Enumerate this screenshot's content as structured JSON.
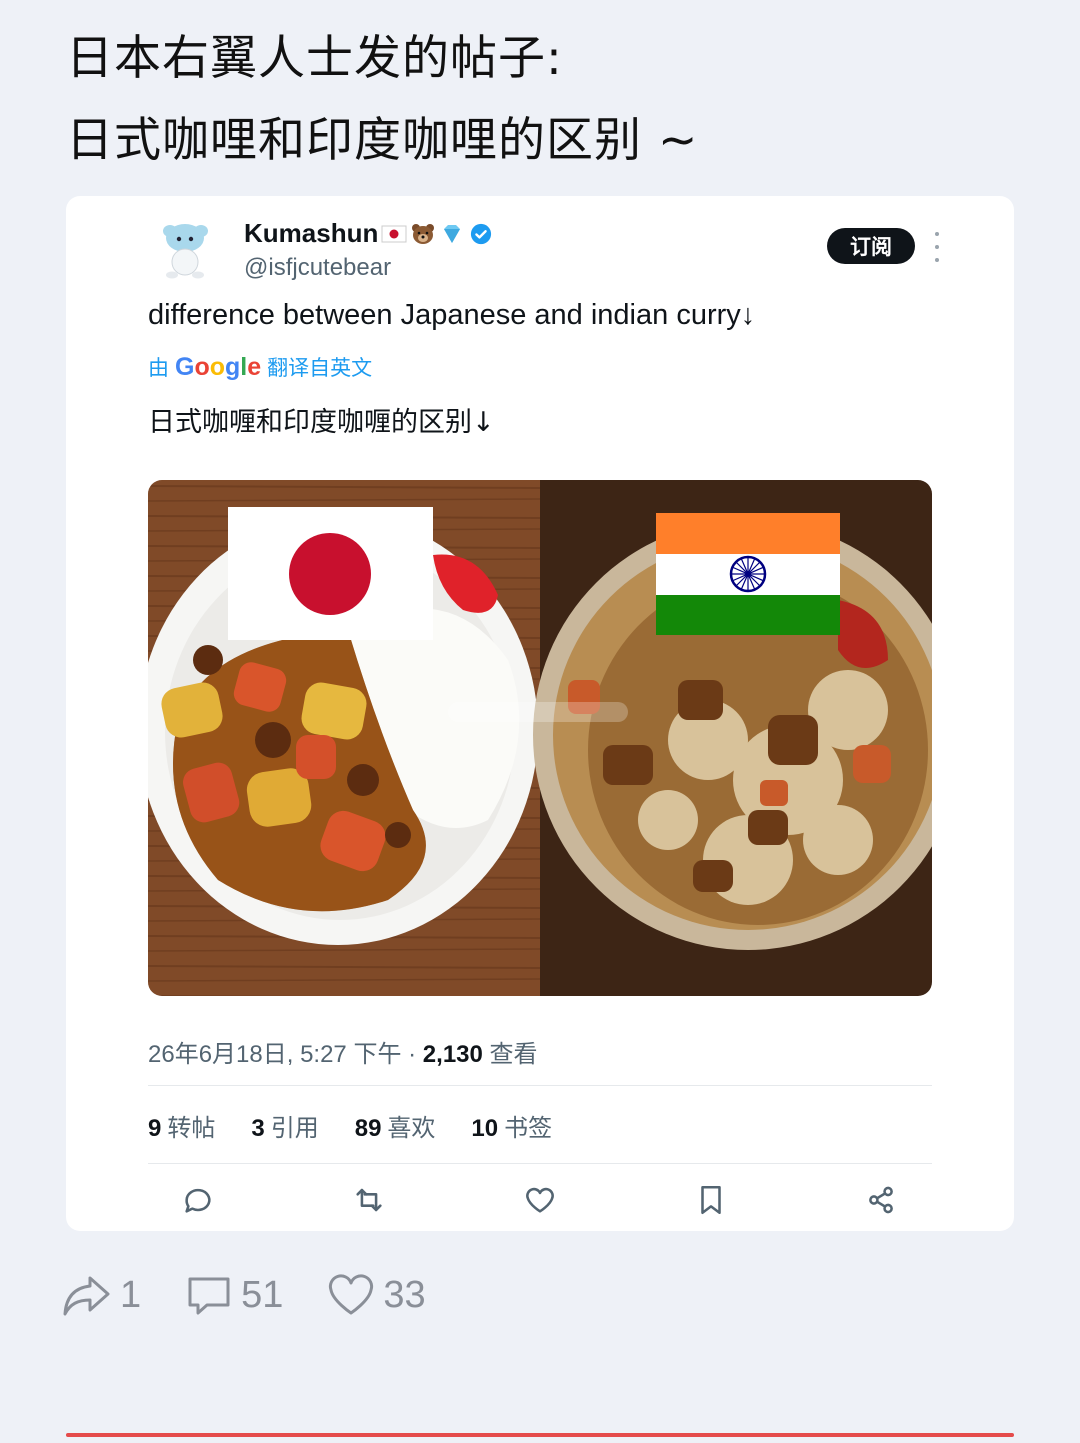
{
  "post": {
    "title_line1": "日本右翼人士发的帖子:",
    "title_line2": "日式咖哩和印度咖哩的区别 ~"
  },
  "tweet": {
    "display_name": "Kumashun",
    "handle": "@isfjcutebear",
    "subscribe_label": "订阅",
    "text": "difference between Japanese and indian curry↓",
    "translated_prefix": "由",
    "translated_brand": "Google",
    "translated_suffix": "翻译自英文",
    "translated_text": "日式咖喱和印度咖喱的区别↓",
    "timestamp": "26年6月18日, 5:27 下午 ·",
    "views_count": "2,130",
    "views_label": "查看",
    "stats": [
      {
        "count": "9",
        "label": "转帖"
      },
      {
        "count": "3",
        "label": "引用"
      },
      {
        "count": "89",
        "label": "喜欢"
      },
      {
        "count": "10",
        "label": "书签"
      }
    ]
  },
  "bottom_actions": {
    "share_count": "1",
    "comment_count": "51",
    "like_count": "33"
  },
  "colors": {
    "accent": "#1d9bf0",
    "japan_red": "#c8102e",
    "india_saffron": "#ff7f2a",
    "india_green": "#138808",
    "chakra": "#000080",
    "bottom_line": "#e54b4b"
  },
  "icons": [
    "reply-icon",
    "retweet-icon",
    "like-icon",
    "bookmark-icon",
    "share-icon",
    "forward-icon",
    "comment-icon",
    "heart-icon",
    "verified-icon"
  ]
}
